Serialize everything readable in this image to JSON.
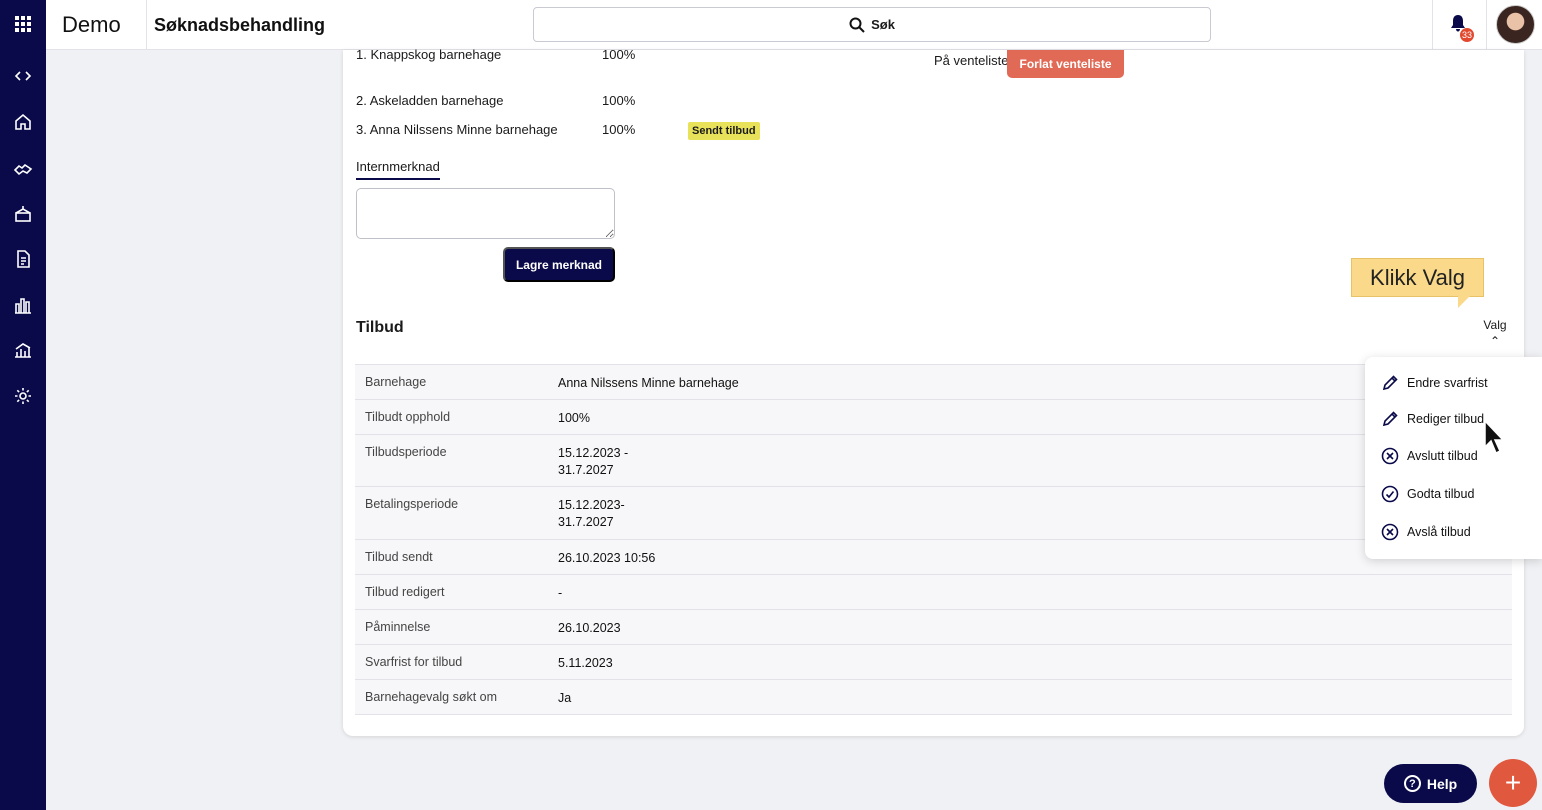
{
  "header": {
    "brand": "Demo",
    "title": "Søknadsbehandling",
    "search_label": "Søk",
    "notification_count": "33"
  },
  "choices": [
    {
      "label": "1. Knappskog barnehage",
      "percent": "100%"
    },
    {
      "label": "2. Askeladden barnehage",
      "percent": "100%"
    },
    {
      "label": "3. Anna Nilssens Minne barnehage",
      "percent": "100%",
      "status": "Sendt tilbud"
    }
  ],
  "waitlist": {
    "label": "På venteliste",
    "button": "Forlat venteliste"
  },
  "note": {
    "tab": "Internmerknad",
    "save_button": "Lagre merknad"
  },
  "offer": {
    "title": "Tilbud",
    "options_label": "Valg",
    "rows": [
      {
        "key": "Barnehage",
        "value": "Anna Nilssens Minne barnehage"
      },
      {
        "key": "Tilbudt opphold",
        "value": "100%"
      },
      {
        "key": "Tilbudsperiode",
        "value_line1": "15.12.2023 -",
        "value_line2": "31.7.2027"
      },
      {
        "key": "Betalingsperiode",
        "value_line1": "15.12.2023-",
        "value_line2": "31.7.2027"
      },
      {
        "key": "Tilbud sendt",
        "value": "26.10.2023 10:56"
      },
      {
        "key": "Tilbud redigert",
        "value": "-"
      },
      {
        "key": "Påminnelse",
        "value": "26.10.2023"
      },
      {
        "key": "Svarfrist for tilbud",
        "value": "5.11.2023"
      },
      {
        "key": "Barnehagevalg søkt om",
        "value": "Ja"
      }
    ]
  },
  "tooltip": "Klikk Valg",
  "menu": {
    "items": [
      {
        "label": "Endre svarfrist",
        "icon": "pencil-icon"
      },
      {
        "label": "Rediger tilbud",
        "icon": "pencil-icon"
      },
      {
        "label": "Avslutt tilbud",
        "icon": "x-circle-icon"
      },
      {
        "label": "Godta tilbud",
        "icon": "check-circle-icon"
      },
      {
        "label": "Avslå tilbud",
        "icon": "x-circle-icon"
      }
    ]
  },
  "help_button": "Help",
  "colors": {
    "navy": "#0a0a4a",
    "accent_red": "#e0583e",
    "tag_yellow": "#e8e15a",
    "tooltip_yellow": "#fad98a"
  }
}
